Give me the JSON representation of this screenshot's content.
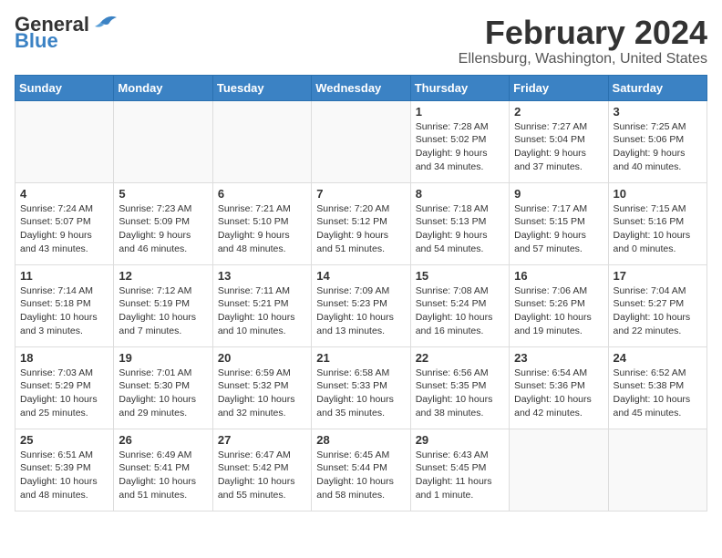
{
  "logo": {
    "general": "General",
    "blue": "Blue"
  },
  "header": {
    "month": "February 2024",
    "location": "Ellensburg, Washington, United States"
  },
  "days_of_week": [
    "Sunday",
    "Monday",
    "Tuesday",
    "Wednesday",
    "Thursday",
    "Friday",
    "Saturday"
  ],
  "weeks": [
    [
      {
        "day": "",
        "info": ""
      },
      {
        "day": "",
        "info": ""
      },
      {
        "day": "",
        "info": ""
      },
      {
        "day": "",
        "info": ""
      },
      {
        "day": "1",
        "info": "Sunrise: 7:28 AM\nSunset: 5:02 PM\nDaylight: 9 hours\nand 34 minutes."
      },
      {
        "day": "2",
        "info": "Sunrise: 7:27 AM\nSunset: 5:04 PM\nDaylight: 9 hours\nand 37 minutes."
      },
      {
        "day": "3",
        "info": "Sunrise: 7:25 AM\nSunset: 5:06 PM\nDaylight: 9 hours\nand 40 minutes."
      }
    ],
    [
      {
        "day": "4",
        "info": "Sunrise: 7:24 AM\nSunset: 5:07 PM\nDaylight: 9 hours\nand 43 minutes."
      },
      {
        "day": "5",
        "info": "Sunrise: 7:23 AM\nSunset: 5:09 PM\nDaylight: 9 hours\nand 46 minutes."
      },
      {
        "day": "6",
        "info": "Sunrise: 7:21 AM\nSunset: 5:10 PM\nDaylight: 9 hours\nand 48 minutes."
      },
      {
        "day": "7",
        "info": "Sunrise: 7:20 AM\nSunset: 5:12 PM\nDaylight: 9 hours\nand 51 minutes."
      },
      {
        "day": "8",
        "info": "Sunrise: 7:18 AM\nSunset: 5:13 PM\nDaylight: 9 hours\nand 54 minutes."
      },
      {
        "day": "9",
        "info": "Sunrise: 7:17 AM\nSunset: 5:15 PM\nDaylight: 9 hours\nand 57 minutes."
      },
      {
        "day": "10",
        "info": "Sunrise: 7:15 AM\nSunset: 5:16 PM\nDaylight: 10 hours\nand 0 minutes."
      }
    ],
    [
      {
        "day": "11",
        "info": "Sunrise: 7:14 AM\nSunset: 5:18 PM\nDaylight: 10 hours\nand 3 minutes."
      },
      {
        "day": "12",
        "info": "Sunrise: 7:12 AM\nSunset: 5:19 PM\nDaylight: 10 hours\nand 7 minutes."
      },
      {
        "day": "13",
        "info": "Sunrise: 7:11 AM\nSunset: 5:21 PM\nDaylight: 10 hours\nand 10 minutes."
      },
      {
        "day": "14",
        "info": "Sunrise: 7:09 AM\nSunset: 5:23 PM\nDaylight: 10 hours\nand 13 minutes."
      },
      {
        "day": "15",
        "info": "Sunrise: 7:08 AM\nSunset: 5:24 PM\nDaylight: 10 hours\nand 16 minutes."
      },
      {
        "day": "16",
        "info": "Sunrise: 7:06 AM\nSunset: 5:26 PM\nDaylight: 10 hours\nand 19 minutes."
      },
      {
        "day": "17",
        "info": "Sunrise: 7:04 AM\nSunset: 5:27 PM\nDaylight: 10 hours\nand 22 minutes."
      }
    ],
    [
      {
        "day": "18",
        "info": "Sunrise: 7:03 AM\nSunset: 5:29 PM\nDaylight: 10 hours\nand 25 minutes."
      },
      {
        "day": "19",
        "info": "Sunrise: 7:01 AM\nSunset: 5:30 PM\nDaylight: 10 hours\nand 29 minutes."
      },
      {
        "day": "20",
        "info": "Sunrise: 6:59 AM\nSunset: 5:32 PM\nDaylight: 10 hours\nand 32 minutes."
      },
      {
        "day": "21",
        "info": "Sunrise: 6:58 AM\nSunset: 5:33 PM\nDaylight: 10 hours\nand 35 minutes."
      },
      {
        "day": "22",
        "info": "Sunrise: 6:56 AM\nSunset: 5:35 PM\nDaylight: 10 hours\nand 38 minutes."
      },
      {
        "day": "23",
        "info": "Sunrise: 6:54 AM\nSunset: 5:36 PM\nDaylight: 10 hours\nand 42 minutes."
      },
      {
        "day": "24",
        "info": "Sunrise: 6:52 AM\nSunset: 5:38 PM\nDaylight: 10 hours\nand 45 minutes."
      }
    ],
    [
      {
        "day": "25",
        "info": "Sunrise: 6:51 AM\nSunset: 5:39 PM\nDaylight: 10 hours\nand 48 minutes."
      },
      {
        "day": "26",
        "info": "Sunrise: 6:49 AM\nSunset: 5:41 PM\nDaylight: 10 hours\nand 51 minutes."
      },
      {
        "day": "27",
        "info": "Sunrise: 6:47 AM\nSunset: 5:42 PM\nDaylight: 10 hours\nand 55 minutes."
      },
      {
        "day": "28",
        "info": "Sunrise: 6:45 AM\nSunset: 5:44 PM\nDaylight: 10 hours\nand 58 minutes."
      },
      {
        "day": "29",
        "info": "Sunrise: 6:43 AM\nSunset: 5:45 PM\nDaylight: 11 hours\nand 1 minute."
      },
      {
        "day": "",
        "info": ""
      },
      {
        "day": "",
        "info": ""
      }
    ]
  ]
}
